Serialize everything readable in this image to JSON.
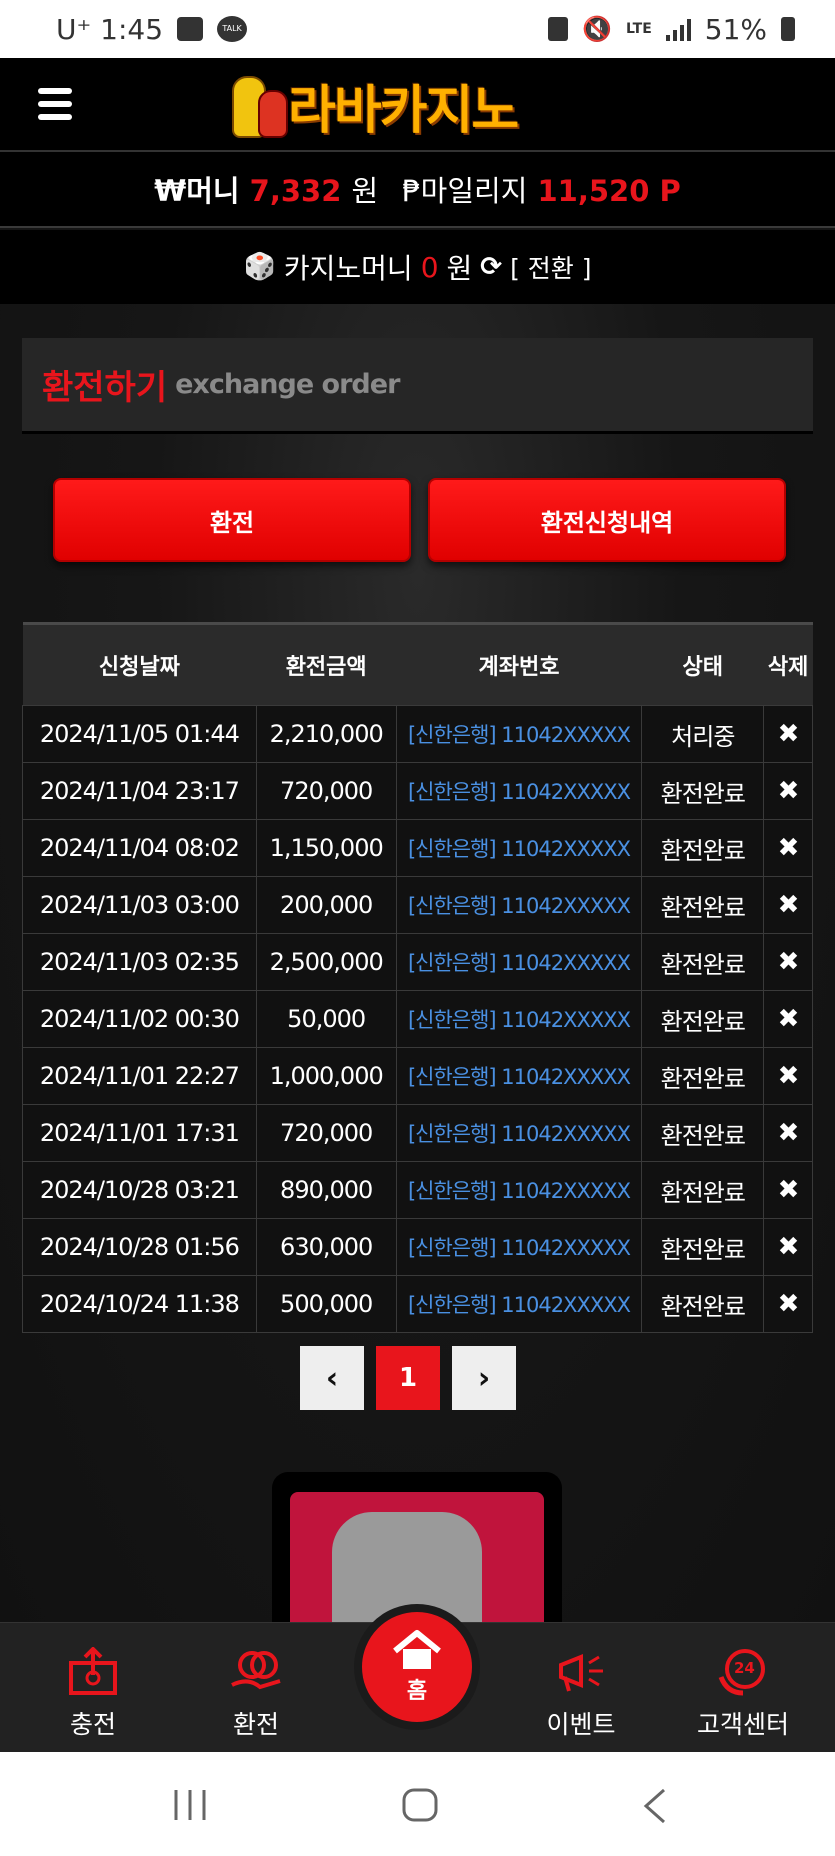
{
  "status_bar": {
    "carrier_time": "U⁺ 1:45",
    "talk_badge": "TALK",
    "network": "LTE",
    "battery": "51%"
  },
  "header": {
    "logo_text": "라바카지노"
  },
  "money": {
    "money_label": "₩머니",
    "money_value": "7,332",
    "money_unit": "원",
    "mileage_label": "₱마일리지",
    "mileage_value": "11,520",
    "mileage_unit": "P"
  },
  "casino": {
    "label": "카지노머니",
    "value": "0",
    "unit": "원",
    "convert_label": "[ 전환 ]"
  },
  "section": {
    "title_ko": "환전하기",
    "title_en": "exchange order"
  },
  "buttons": {
    "exchange": "환전",
    "history": "환전신청내역"
  },
  "table": {
    "headers": [
      "신청날짜",
      "환전금액",
      "계좌번호",
      "상태",
      "삭제"
    ],
    "rows": [
      {
        "date": "2024/11/05 01:44",
        "amount": "2,210,000",
        "account": "[신한은행] 11042XXXXX",
        "status": "처리중",
        "del": "✖"
      },
      {
        "date": "2024/11/04 23:17",
        "amount": "720,000",
        "account": "[신한은행] 11042XXXXX",
        "status": "환전완료",
        "del": "✖"
      },
      {
        "date": "2024/11/04 08:02",
        "amount": "1,150,000",
        "account": "[신한은행] 11042XXXXX",
        "status": "환전완료",
        "del": "✖"
      },
      {
        "date": "2024/11/03 03:00",
        "amount": "200,000",
        "account": "[신한은행] 11042XXXXX",
        "status": "환전완료",
        "del": "✖"
      },
      {
        "date": "2024/11/03 02:35",
        "amount": "2,500,000",
        "account": "[신한은행] 11042XXXXX",
        "status": "환전완료",
        "del": "✖"
      },
      {
        "date": "2024/11/02 00:30",
        "amount": "50,000",
        "account": "[신한은행] 11042XXXXX",
        "status": "환전완료",
        "del": "✖"
      },
      {
        "date": "2024/11/01 22:27",
        "amount": "1,000,000",
        "account": "[신한은행] 11042XXXXX",
        "status": "환전완료",
        "del": "✖"
      },
      {
        "date": "2024/11/01 17:31",
        "amount": "720,000",
        "account": "[신한은행] 11042XXXXX",
        "status": "환전완료",
        "del": "✖"
      },
      {
        "date": "2024/10/28 03:21",
        "amount": "890,000",
        "account": "[신한은행] 11042XXXXX",
        "status": "환전완료",
        "del": "✖"
      },
      {
        "date": "2024/10/28 01:56",
        "amount": "630,000",
        "account": "[신한은행] 11042XXXXX",
        "status": "환전완료",
        "del": "✖"
      },
      {
        "date": "2024/10/24 11:38",
        "amount": "500,000",
        "account": "[신한은행] 11042XXXXX",
        "status": "환전완료",
        "del": "✖"
      }
    ]
  },
  "pagination": {
    "prev": "‹",
    "current": "1",
    "next": "›"
  },
  "bottom_nav": {
    "charge": "충전",
    "exchange": "환전",
    "home": "홈",
    "event": "이벤트",
    "support": "고객센터",
    "support_badge": "24"
  },
  "colors": {
    "accent_red": "#e8151c",
    "account_blue": "#4a90e2"
  }
}
